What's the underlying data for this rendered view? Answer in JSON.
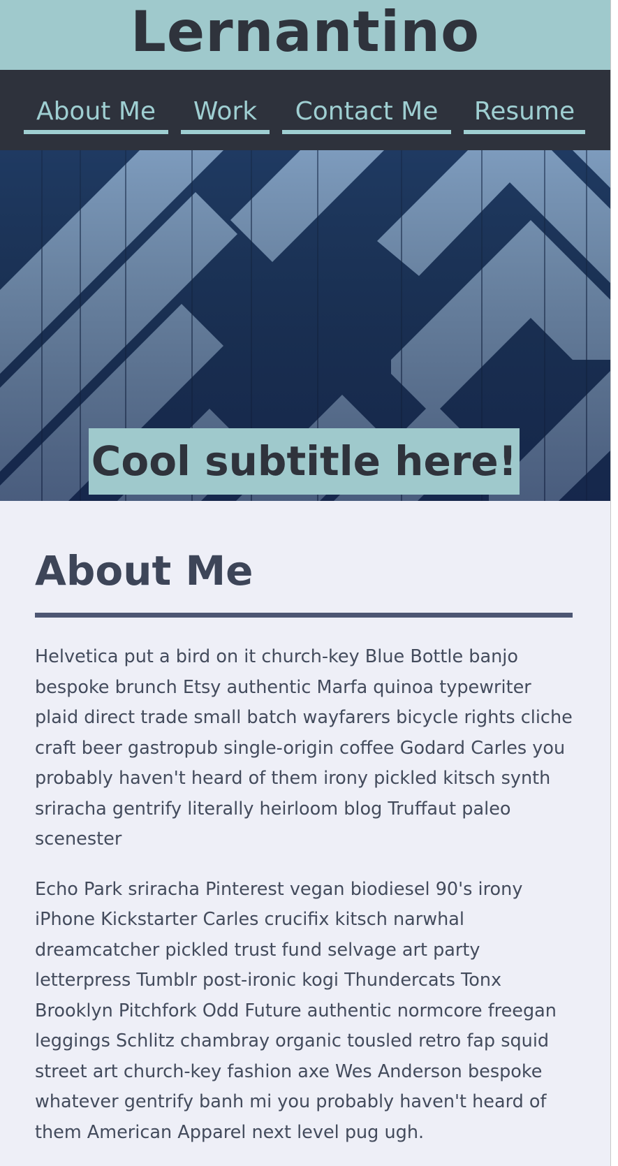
{
  "header": {
    "title": "Lernantino"
  },
  "nav": {
    "items": [
      {
        "label": "About Me"
      },
      {
        "label": "Work"
      },
      {
        "label": "Contact Me"
      },
      {
        "label": "Resume"
      }
    ]
  },
  "hero": {
    "subtitle": "Cool subtitle here!"
  },
  "about": {
    "heading": "About Me",
    "paragraphs": [
      "Helvetica put a bird on it church-key Blue Bottle banjo bespoke brunch Etsy authentic Marfa quinoa typewriter plaid direct trade small batch wayfarers bicycle rights cliche craft beer gastropub single-origin coffee Godard Carles you probably haven't heard of them irony pickled kitsch synth sriracha gentrify literally heirloom blog Truffaut paleo scenester",
      "Echo Park sriracha Pinterest vegan biodiesel 90's irony iPhone Kickstarter Carles crucifix kitsch narwhal dreamcatcher pickled trust fund selvage art party letterpress Tumblr post-ironic kogi Thundercats Tonx Brooklyn Pitchfork Odd Future authentic normcore freegan leggings Schlitz chambray organic tousled retro fap squid street art church-key fashion axe Wes Anderson bespoke whatever gentrify banh mi you probably haven't heard of them American Apparel next level pug ugh."
    ]
  },
  "colors": {
    "header_bg": "#9fc9cc",
    "nav_bg": "#2e323c",
    "nav_link": "#9fcfd2",
    "page_bg": "#eeeff7",
    "heading": "#3d4558",
    "body_text": "#434b5c"
  }
}
